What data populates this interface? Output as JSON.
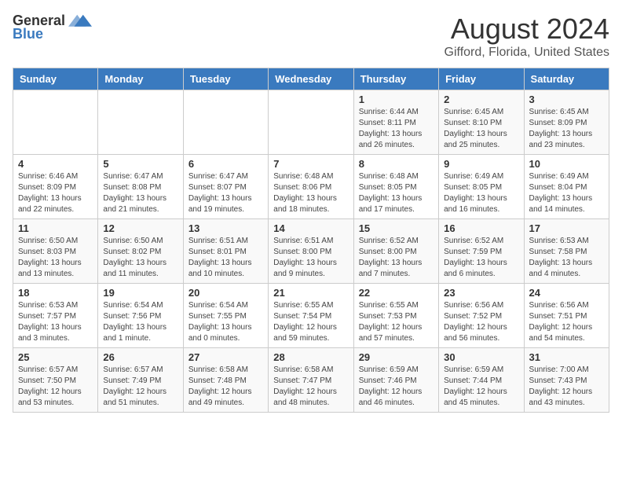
{
  "logo": {
    "general": "General",
    "blue": "Blue"
  },
  "title": "August 2024",
  "subtitle": "Gifford, Florida, United States",
  "weekdays": [
    "Sunday",
    "Monday",
    "Tuesday",
    "Wednesday",
    "Thursday",
    "Friday",
    "Saturday"
  ],
  "weeks": [
    [
      {
        "day": "",
        "content": ""
      },
      {
        "day": "",
        "content": ""
      },
      {
        "day": "",
        "content": ""
      },
      {
        "day": "",
        "content": ""
      },
      {
        "day": "1",
        "content": "Sunrise: 6:44 AM\nSunset: 8:11 PM\nDaylight: 13 hours and 26 minutes."
      },
      {
        "day": "2",
        "content": "Sunrise: 6:45 AM\nSunset: 8:10 PM\nDaylight: 13 hours and 25 minutes."
      },
      {
        "day": "3",
        "content": "Sunrise: 6:45 AM\nSunset: 8:09 PM\nDaylight: 13 hours and 23 minutes."
      }
    ],
    [
      {
        "day": "4",
        "content": "Sunrise: 6:46 AM\nSunset: 8:09 PM\nDaylight: 13 hours and 22 minutes."
      },
      {
        "day": "5",
        "content": "Sunrise: 6:47 AM\nSunset: 8:08 PM\nDaylight: 13 hours and 21 minutes."
      },
      {
        "day": "6",
        "content": "Sunrise: 6:47 AM\nSunset: 8:07 PM\nDaylight: 13 hours and 19 minutes."
      },
      {
        "day": "7",
        "content": "Sunrise: 6:48 AM\nSunset: 8:06 PM\nDaylight: 13 hours and 18 minutes."
      },
      {
        "day": "8",
        "content": "Sunrise: 6:48 AM\nSunset: 8:05 PM\nDaylight: 13 hours and 17 minutes."
      },
      {
        "day": "9",
        "content": "Sunrise: 6:49 AM\nSunset: 8:05 PM\nDaylight: 13 hours and 16 minutes."
      },
      {
        "day": "10",
        "content": "Sunrise: 6:49 AM\nSunset: 8:04 PM\nDaylight: 13 hours and 14 minutes."
      }
    ],
    [
      {
        "day": "11",
        "content": "Sunrise: 6:50 AM\nSunset: 8:03 PM\nDaylight: 13 hours and 13 minutes."
      },
      {
        "day": "12",
        "content": "Sunrise: 6:50 AM\nSunset: 8:02 PM\nDaylight: 13 hours and 11 minutes."
      },
      {
        "day": "13",
        "content": "Sunrise: 6:51 AM\nSunset: 8:01 PM\nDaylight: 13 hours and 10 minutes."
      },
      {
        "day": "14",
        "content": "Sunrise: 6:51 AM\nSunset: 8:00 PM\nDaylight: 13 hours and 9 minutes."
      },
      {
        "day": "15",
        "content": "Sunrise: 6:52 AM\nSunset: 8:00 PM\nDaylight: 13 hours and 7 minutes."
      },
      {
        "day": "16",
        "content": "Sunrise: 6:52 AM\nSunset: 7:59 PM\nDaylight: 13 hours and 6 minutes."
      },
      {
        "day": "17",
        "content": "Sunrise: 6:53 AM\nSunset: 7:58 PM\nDaylight: 13 hours and 4 minutes."
      }
    ],
    [
      {
        "day": "18",
        "content": "Sunrise: 6:53 AM\nSunset: 7:57 PM\nDaylight: 13 hours and 3 minutes."
      },
      {
        "day": "19",
        "content": "Sunrise: 6:54 AM\nSunset: 7:56 PM\nDaylight: 13 hours and 1 minute."
      },
      {
        "day": "20",
        "content": "Sunrise: 6:54 AM\nSunset: 7:55 PM\nDaylight: 13 hours and 0 minutes."
      },
      {
        "day": "21",
        "content": "Sunrise: 6:55 AM\nSunset: 7:54 PM\nDaylight: 12 hours and 59 minutes."
      },
      {
        "day": "22",
        "content": "Sunrise: 6:55 AM\nSunset: 7:53 PM\nDaylight: 12 hours and 57 minutes."
      },
      {
        "day": "23",
        "content": "Sunrise: 6:56 AM\nSunset: 7:52 PM\nDaylight: 12 hours and 56 minutes."
      },
      {
        "day": "24",
        "content": "Sunrise: 6:56 AM\nSunset: 7:51 PM\nDaylight: 12 hours and 54 minutes."
      }
    ],
    [
      {
        "day": "25",
        "content": "Sunrise: 6:57 AM\nSunset: 7:50 PM\nDaylight: 12 hours and 53 minutes."
      },
      {
        "day": "26",
        "content": "Sunrise: 6:57 AM\nSunset: 7:49 PM\nDaylight: 12 hours and 51 minutes."
      },
      {
        "day": "27",
        "content": "Sunrise: 6:58 AM\nSunset: 7:48 PM\nDaylight: 12 hours and 49 minutes."
      },
      {
        "day": "28",
        "content": "Sunrise: 6:58 AM\nSunset: 7:47 PM\nDaylight: 12 hours and 48 minutes."
      },
      {
        "day": "29",
        "content": "Sunrise: 6:59 AM\nSunset: 7:46 PM\nDaylight: 12 hours and 46 minutes."
      },
      {
        "day": "30",
        "content": "Sunrise: 6:59 AM\nSunset: 7:44 PM\nDaylight: 12 hours and 45 minutes."
      },
      {
        "day": "31",
        "content": "Sunrise: 7:00 AM\nSunset: 7:43 PM\nDaylight: 12 hours and 43 minutes."
      }
    ]
  ]
}
